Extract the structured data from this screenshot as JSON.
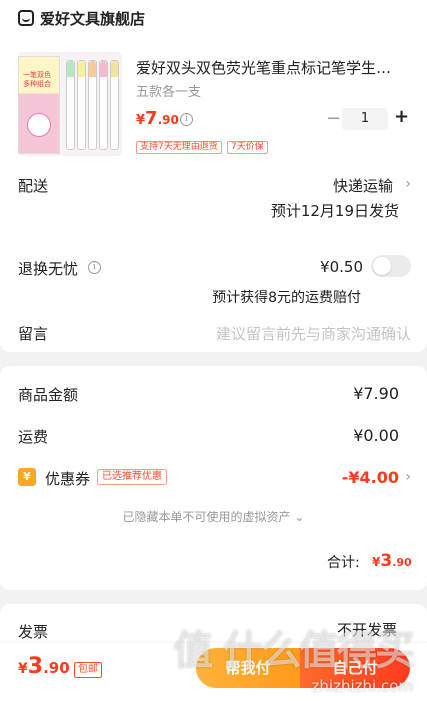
{
  "store": {
    "name": "爱好文具旗舰店",
    "icon": "store-icon"
  },
  "product": {
    "title": "爱好双头双色荧光笔重点标记笔学生…",
    "variant": "五款各一支",
    "price_currency": "¥",
    "price_int": "7",
    "price_dec": ".90",
    "quantity": "1",
    "minus_label": "−",
    "plus_label": "+",
    "tags": [
      "支持7天无理由退货",
      "7天价保"
    ],
    "image_text": "一笔双色 多种组合"
  },
  "delivery": {
    "label": "配送",
    "method": "快递运输",
    "eta": "预计12月19日发货"
  },
  "return_insurance": {
    "label": "退换无忧",
    "price": "¥0.50",
    "note": "预计获得8元的运费赔付",
    "enabled": false
  },
  "message": {
    "label": "留言",
    "placeholder": "建议留言前先与商家沟通确认"
  },
  "summary": {
    "goods_label": "商品金额",
    "goods_amount": "¥7.90",
    "shipping_label": "运费",
    "shipping_amount": "¥0.00",
    "coupon_icon_text": "¥",
    "coupon_label": "优惠券",
    "coupon_badge": "已选推荐优惠",
    "coupon_amount": "-¥4.00",
    "hidden_assets": "已隐藏本单不可使用的虚拟资产",
    "total_label": "合计:",
    "total_currency": "¥",
    "total_int": "3",
    "total_dec": ".90"
  },
  "invoice": {
    "label": "发票",
    "value": "不开发票"
  },
  "bottom_bar": {
    "pay_currency": "¥",
    "pay_int": "3",
    "pay_dec": ".90",
    "free_shipping": "包邮",
    "helper_button": "帮我付",
    "pay_button": "自己付"
  },
  "watermark": {
    "logo": "值 什么值得买",
    "text": "zhizhizhi.com"
  },
  "colors": {
    "accent": "#ff3b1f",
    "helper": "#ffa726",
    "background": "#f2f2f2"
  }
}
